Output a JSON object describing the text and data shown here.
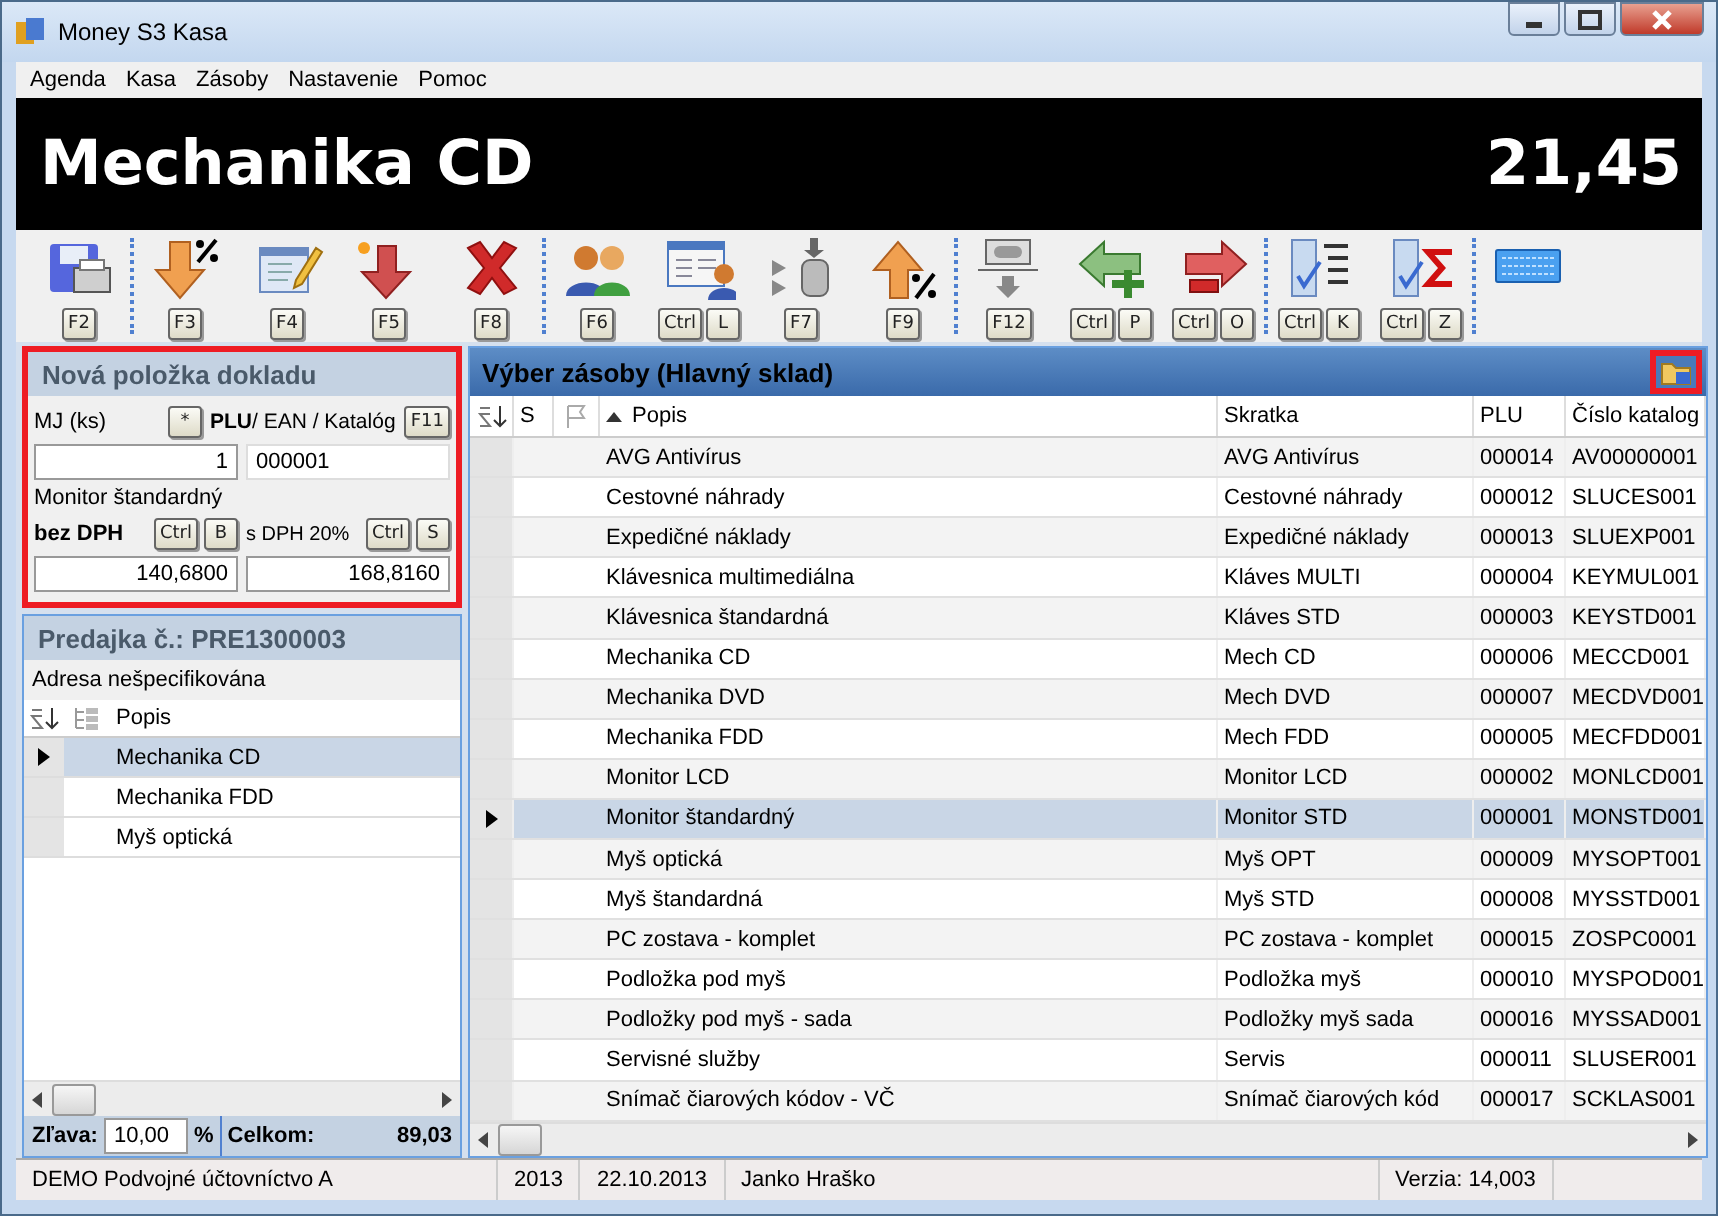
{
  "window": {
    "title": "Money S3 Kasa"
  },
  "menu": [
    "Agenda",
    "Kasa",
    "Zásoby",
    "Nastavenie",
    "Pomoc"
  ],
  "banner": {
    "item": "Mechanika CD",
    "price": "21,45"
  },
  "toolbar": [
    [
      {
        "keys": [
          "F2"
        ]
      }
    ],
    [
      {
        "keys": [
          "F3"
        ]
      },
      {
        "keys": [
          "F4"
        ]
      },
      {
        "keys": [
          "F5"
        ]
      },
      {
        "keys": [
          "F8"
        ]
      }
    ],
    [
      {
        "keys": [
          "F6"
        ]
      },
      {
        "keys": [
          "Ctrl",
          "L"
        ]
      },
      {
        "keys": [
          "F7"
        ]
      },
      {
        "keys": [
          "F9"
        ]
      }
    ],
    [
      {
        "keys": [
          "F12"
        ]
      },
      {
        "keys": [
          "Ctrl",
          "P"
        ]
      },
      {
        "keys": [
          "Ctrl",
          "O"
        ]
      }
    ],
    [
      {
        "keys": [
          "Ctrl",
          "K"
        ]
      },
      {
        "keys": [
          "Ctrl",
          "Z"
        ]
      }
    ]
  ],
  "new_item": {
    "title": "Nová položka dokladu",
    "unit_label": "MJ (ks)",
    "star_key": "*",
    "code_label": "**PLU**/ EAN / Katalóg",
    "code_key": "F11",
    "quantity": "1",
    "code": "000001",
    "product": "Monitor štandardný",
    "net_label": "bez DPH",
    "net_keys": [
      "Ctrl",
      "B"
    ],
    "gross_label": "s DPH 20%",
    "gross_keys": [
      "Ctrl",
      "S"
    ],
    "net_price": "140,6800",
    "gross_price": "168,8160"
  },
  "receipt": {
    "title": "Predajka č.: PRE1300003",
    "address": "Adresa nešpecifikována",
    "column": "Popis",
    "rows": [
      {
        "name": "Mechanika CD",
        "selected": true
      },
      {
        "name": "Mechanika FDD",
        "selected": false
      },
      {
        "name": "Myš optická",
        "selected": false
      }
    ],
    "discount_label": "Zľava:",
    "discount": "10,00",
    "percent": "%",
    "total_label": "Celkom:",
    "total": "89,03"
  },
  "stock": {
    "title": "Výber zásoby (Hlavný sklad)",
    "columns": [
      "S",
      "Popis",
      "Skratka",
      "PLU",
      "Číslo katalog"
    ],
    "rows": [
      {
        "name": "AVG Antivírus",
        "short": "AVG Antivírus",
        "plu": "000014",
        "catalog": "AV00000001",
        "selected": false
      },
      {
        "name": "Cestovné náhrady",
        "short": "Cestovné náhrady",
        "plu": "000012",
        "catalog": "SLUCES001",
        "selected": false
      },
      {
        "name": "Expedičné náklady",
        "short": "Expedičné náklady",
        "plu": "000013",
        "catalog": "SLUEXP001",
        "selected": false
      },
      {
        "name": "Klávesnica multimediálna",
        "short": "Kláves MULTI",
        "plu": "000004",
        "catalog": "KEYMUL001",
        "selected": false
      },
      {
        "name": "Klávesnica štandardná",
        "short": "Kláves STD",
        "plu": "000003",
        "catalog": "KEYSTD001",
        "selected": false
      },
      {
        "name": "Mechanika CD",
        "short": "Mech CD",
        "plu": "000006",
        "catalog": "MECCD001",
        "selected": false
      },
      {
        "name": "Mechanika DVD",
        "short": "Mech DVD",
        "plu": "000007",
        "catalog": "MECDVD001",
        "selected": false
      },
      {
        "name": "Mechanika FDD",
        "short": "Mech FDD",
        "plu": "000005",
        "catalog": "MECFDD001",
        "selected": false
      },
      {
        "name": "Monitor LCD",
        "short": "Monitor LCD",
        "plu": "000002",
        "catalog": "MONLCD001",
        "selected": false
      },
      {
        "name": "Monitor štandardný",
        "short": "Monitor STD",
        "plu": "000001",
        "catalog": "MONSTD001",
        "selected": true
      },
      {
        "name": "Myš optická",
        "short": "Myš OPT",
        "plu": "000009",
        "catalog": "MYSOPT001",
        "selected": false
      },
      {
        "name": "Myš štandardná",
        "short": "Myš STD",
        "plu": "000008",
        "catalog": "MYSSTD001",
        "selected": false
      },
      {
        "name": "PC zostava - komplet",
        "short": "PC zostava - komplet",
        "plu": "000015",
        "catalog": "ZOSPC0001",
        "selected": false
      },
      {
        "name": "Podložka pod myš",
        "short": "Podložka myš",
        "plu": "000010",
        "catalog": "MYSPOD001",
        "selected": false
      },
      {
        "name": "Podložky pod myš - sada",
        "short": "Podložky myš sada",
        "plu": "000016",
        "catalog": "MYSSAD001",
        "selected": false
      },
      {
        "name": "Servisné služby",
        "short": "Servis",
        "plu": "000011",
        "catalog": "SLUSER001",
        "selected": false
      },
      {
        "name": "Snímač čiarových kódov - VČ",
        "short": "Snímač čiarových kód",
        "plu": "000017",
        "catalog": "SCKLAS001",
        "selected": false
      }
    ]
  },
  "status_bar": [
    "DEMO Podvojné účtovníctvo A",
    "2013",
    "22.10.2013",
    "Janko Hraško",
    "Verzia: 14,003"
  ]
}
